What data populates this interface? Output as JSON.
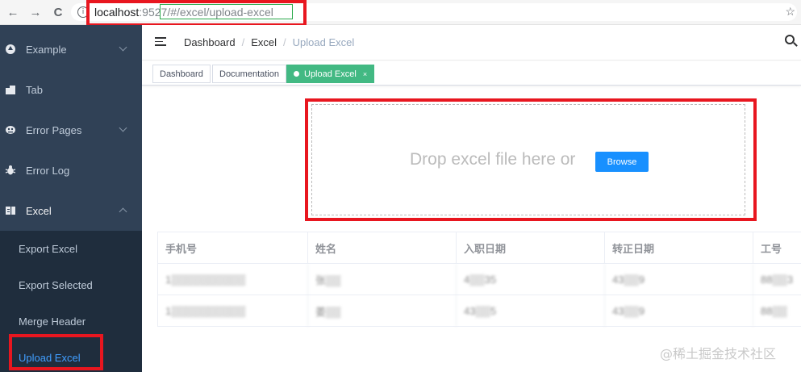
{
  "browser": {
    "back_icon": "←",
    "forward_icon": "→",
    "reload_icon": "C",
    "info_icon": "i",
    "url_host": "localhost",
    "url_port": ":9527",
    "url_path": "/#/excel/upload-excel",
    "star_icon": "☆"
  },
  "sidebar": {
    "items": [
      {
        "label": "Example",
        "icon": "example-icon"
      },
      {
        "label": "Tab",
        "icon": "tab-icon"
      },
      {
        "label": "Error Pages",
        "icon": "error-pages-icon"
      },
      {
        "label": "Error Log",
        "icon": "bug-icon"
      },
      {
        "label": "Excel",
        "icon": "excel-icon"
      }
    ],
    "excel_children": [
      {
        "label": "Export Excel"
      },
      {
        "label": "Export Selected"
      },
      {
        "label": "Merge Header"
      },
      {
        "label": "Upload Excel",
        "active": true
      }
    ],
    "active_color": "#409eff"
  },
  "header": {
    "breadcrumb": [
      "Dashboard",
      "Excel",
      "Upload Excel"
    ],
    "separator": "/"
  },
  "tags": [
    {
      "label": "Dashboard"
    },
    {
      "label": "Documentation"
    },
    {
      "label": "Upload Excel",
      "active": true,
      "close": "×"
    }
  ],
  "upload": {
    "drop_text": "Drop excel file here or",
    "browse_label": "Browse"
  },
  "table": {
    "columns": [
      "手机号",
      "姓名",
      "入职日期",
      "转正日期",
      "工号"
    ],
    "rows": [
      [
        "1▒▒▒▒▒▒▒▒▒▒",
        "张▒▒",
        "4▒▒35",
        "43▒▒9",
        "88▒▒3"
      ],
      [
        "1▒▒▒▒▒▒▒▒▒▒",
        "姜▒▒",
        "43▒▒5",
        "43▒▒9",
        "88▒▒"
      ]
    ]
  },
  "watermark": "@稀土掘金技术社区",
  "colors": {
    "sidebar_bg": "#304156",
    "submenu_bg": "#1f2d3d",
    "tag_active": "#42b983",
    "browse_button": "#1890ff",
    "highlight_red": "#e8161f",
    "highlight_green": "#2aa94b"
  }
}
